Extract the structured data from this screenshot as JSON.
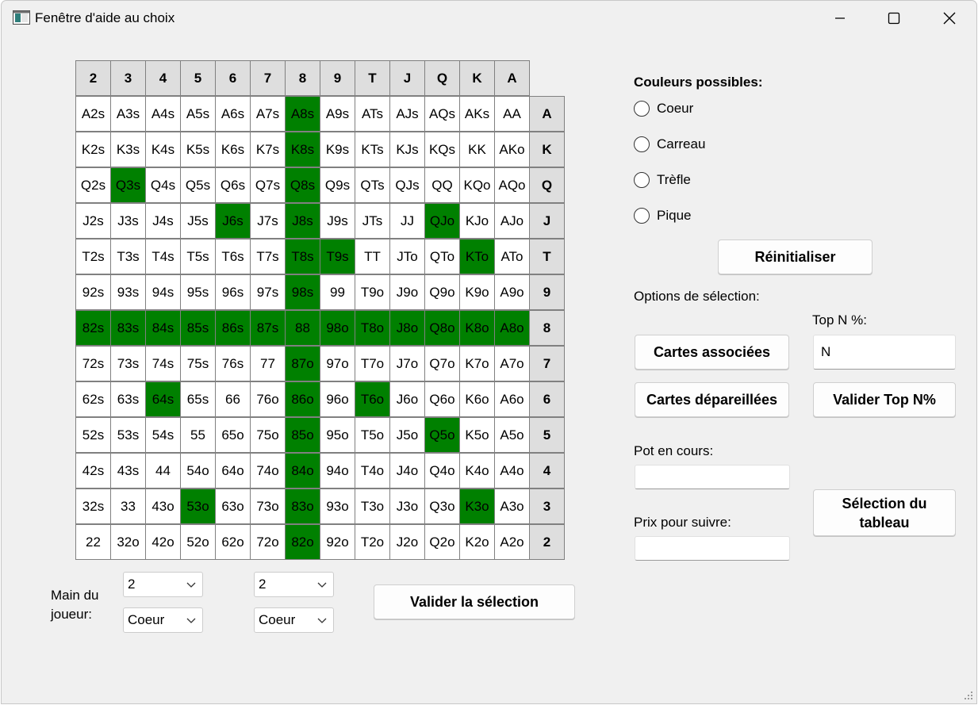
{
  "window": {
    "title": "Fenêtre d'aide au choix"
  },
  "grid": {
    "column_headers": [
      "2",
      "3",
      "4",
      "5",
      "6",
      "7",
      "8",
      "9",
      "T",
      "J",
      "Q",
      "K",
      "A"
    ],
    "rows": [
      {
        "label": "A",
        "cells": [
          "A2s",
          "A3s",
          "A4s",
          "A5s",
          "A6s",
          "A7s",
          "A8s",
          "A9s",
          "ATs",
          "AJs",
          "AQs",
          "AKs",
          "AA"
        ],
        "selected": [
          false,
          false,
          false,
          false,
          false,
          false,
          true,
          false,
          false,
          false,
          false,
          false,
          false
        ]
      },
      {
        "label": "K",
        "cells": [
          "K2s",
          "K3s",
          "K4s",
          "K5s",
          "K6s",
          "K7s",
          "K8s",
          "K9s",
          "KTs",
          "KJs",
          "KQs",
          "KK",
          "AKo"
        ],
        "selected": [
          false,
          false,
          false,
          false,
          false,
          false,
          true,
          false,
          false,
          false,
          false,
          false,
          false
        ]
      },
      {
        "label": "Q",
        "cells": [
          "Q2s",
          "Q3s",
          "Q4s",
          "Q5s",
          "Q6s",
          "Q7s",
          "Q8s",
          "Q9s",
          "QTs",
          "QJs",
          "QQ",
          "KQo",
          "AQo"
        ],
        "selected": [
          false,
          true,
          false,
          false,
          false,
          false,
          true,
          false,
          false,
          false,
          false,
          false,
          false
        ]
      },
      {
        "label": "J",
        "cells": [
          "J2s",
          "J3s",
          "J4s",
          "J5s",
          "J6s",
          "J7s",
          "J8s",
          "J9s",
          "JTs",
          "JJ",
          "QJo",
          "KJo",
          "AJo"
        ],
        "selected": [
          false,
          false,
          false,
          false,
          true,
          false,
          true,
          false,
          false,
          false,
          true,
          false,
          false
        ]
      },
      {
        "label": "T",
        "cells": [
          "T2s",
          "T3s",
          "T4s",
          "T5s",
          "T6s",
          "T7s",
          "T8s",
          "T9s",
          "TT",
          "JTo",
          "QTo",
          "KTo",
          "ATo"
        ],
        "selected": [
          false,
          false,
          false,
          false,
          false,
          false,
          true,
          true,
          false,
          false,
          false,
          true,
          false
        ]
      },
      {
        "label": "9",
        "cells": [
          "92s",
          "93s",
          "94s",
          "95s",
          "96s",
          "97s",
          "98s",
          "99",
          "T9o",
          "J9o",
          "Q9o",
          "K9o",
          "A9o"
        ],
        "selected": [
          false,
          false,
          false,
          false,
          false,
          false,
          true,
          false,
          false,
          false,
          false,
          false,
          false
        ]
      },
      {
        "label": "8",
        "cells": [
          "82s",
          "83s",
          "84s",
          "85s",
          "86s",
          "87s",
          "88",
          "98o",
          "T8o",
          "J8o",
          "Q8o",
          "K8o",
          "A8o"
        ],
        "selected": [
          true,
          true,
          true,
          true,
          true,
          true,
          true,
          true,
          true,
          true,
          true,
          true,
          true
        ]
      },
      {
        "label": "7",
        "cells": [
          "72s",
          "73s",
          "74s",
          "75s",
          "76s",
          "77",
          "87o",
          "97o",
          "T7o",
          "J7o",
          "Q7o",
          "K7o",
          "A7o"
        ],
        "selected": [
          false,
          false,
          false,
          false,
          false,
          false,
          true,
          false,
          false,
          false,
          false,
          false,
          false
        ]
      },
      {
        "label": "6",
        "cells": [
          "62s",
          "63s",
          "64s",
          "65s",
          "66",
          "76o",
          "86o",
          "96o",
          "T6o",
          "J6o",
          "Q6o",
          "K6o",
          "A6o"
        ],
        "selected": [
          false,
          false,
          true,
          false,
          false,
          false,
          true,
          false,
          true,
          false,
          false,
          false,
          false
        ]
      },
      {
        "label": "5",
        "cells": [
          "52s",
          "53s",
          "54s",
          "55",
          "65o",
          "75o",
          "85o",
          "95o",
          "T5o",
          "J5o",
          "Q5o",
          "K5o",
          "A5o"
        ],
        "selected": [
          false,
          false,
          false,
          false,
          false,
          false,
          true,
          false,
          false,
          false,
          true,
          false,
          false
        ]
      },
      {
        "label": "4",
        "cells": [
          "42s",
          "43s",
          "44",
          "54o",
          "64o",
          "74o",
          "84o",
          "94o",
          "T4o",
          "J4o",
          "Q4o",
          "K4o",
          "A4o"
        ],
        "selected": [
          false,
          false,
          false,
          false,
          false,
          false,
          true,
          false,
          false,
          false,
          false,
          false,
          false
        ]
      },
      {
        "label": "3",
        "cells": [
          "32s",
          "33",
          "43o",
          "53o",
          "63o",
          "73o",
          "83o",
          "93o",
          "T3o",
          "J3o",
          "Q3o",
          "K3o",
          "A3o"
        ],
        "selected": [
          false,
          false,
          false,
          true,
          false,
          false,
          true,
          false,
          false,
          false,
          false,
          true,
          false
        ]
      },
      {
        "label": "2",
        "cells": [
          "22",
          "32o",
          "42o",
          "52o",
          "62o",
          "72o",
          "82o",
          "92o",
          "T2o",
          "J2o",
          "Q2o",
          "K2o",
          "A2o"
        ],
        "selected": [
          false,
          false,
          false,
          false,
          false,
          false,
          true,
          false,
          false,
          false,
          false,
          false,
          false
        ]
      }
    ],
    "selected_color": "#008000"
  },
  "colors_panel": {
    "title": "Couleurs possibles:",
    "options": [
      "Coeur",
      "Carreau",
      "Trèfle",
      "Pique"
    ],
    "reset_label": "Réinitialiser"
  },
  "selection_options": {
    "title": "Options de sélection:",
    "associated_label": "Cartes associées",
    "unmatched_label": "Cartes dépareillées",
    "top_n_label": "Top N %:",
    "top_n_value": "N",
    "validate_top_label": "Valider Top N%"
  },
  "pot": {
    "label": "Pot en cours:",
    "value": ""
  },
  "call_price": {
    "label": "Prix pour suivre:",
    "value": ""
  },
  "table_select_label": "Sélection du tableau",
  "player_hand": {
    "label": "Main du joueur:",
    "card1_rank": "2",
    "card1_suit": "Coeur",
    "card2_rank": "2",
    "card2_suit": "Coeur"
  },
  "validate_selection_label": "Valider la sélection"
}
